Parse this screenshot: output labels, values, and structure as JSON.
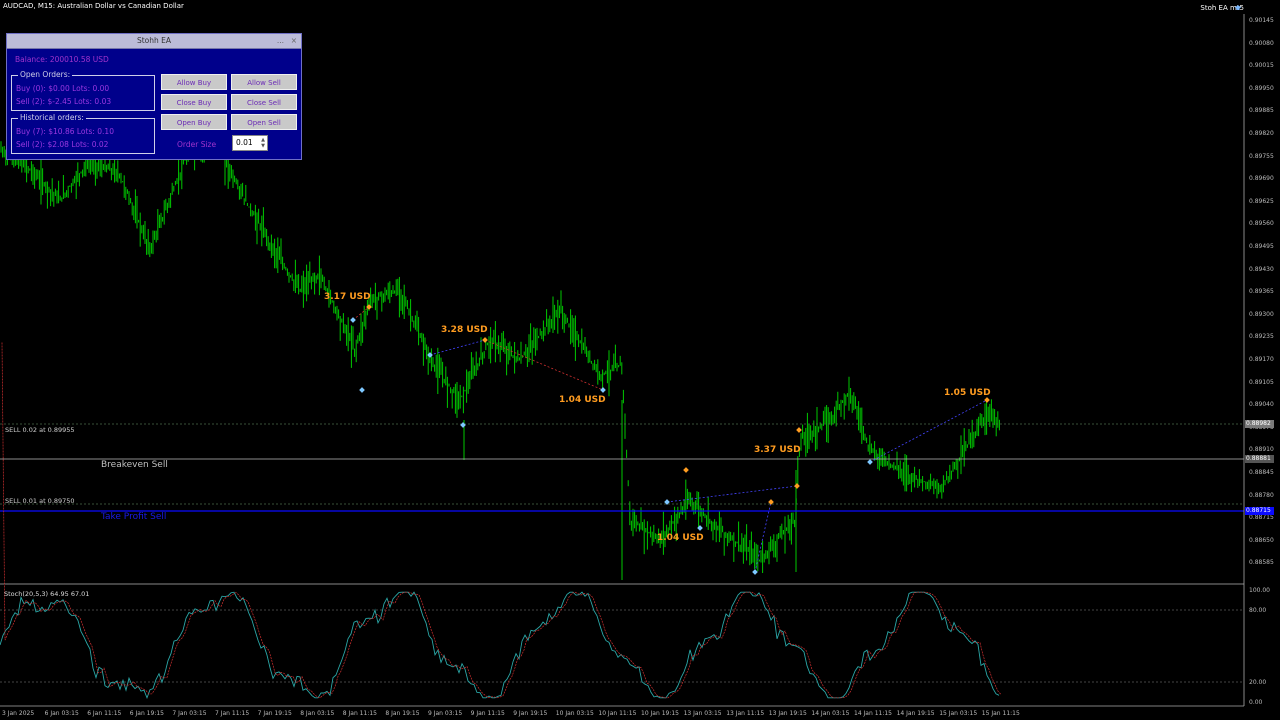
{
  "header": {
    "title": "AUDCAD, M15:  Australian Dollar vs Canadian Dollar",
    "ea_label": "Stoh EA mt5"
  },
  "panel": {
    "title": "Stohh EA",
    "minimize": "...",
    "close": "×",
    "balance": "Balance: 200010.58 USD",
    "open_orders_label": "Open Orders:",
    "open_buy": "Buy (0): $0.00 Lots: 0.00",
    "open_sell": "Sell (2): $-2.45 Lots: 0.03",
    "historical_label": "Historical orders:",
    "hist_buy": "Buy (7): $10.86 Lots: 0.10",
    "hist_sell": "Sell (2): $2.08 Lots: 0.02",
    "buttons": {
      "allow_buy": "Allow Buy",
      "allow_sell": "Allow Sell",
      "close_buy": "Close Buy",
      "close_sell": "Close Sell",
      "open_buy": "Open Buy",
      "open_sell": "Open Sell"
    },
    "order_size_label": "Order Size",
    "order_size_value": "0.01"
  },
  "chart": {
    "level_labels": {
      "sell1": "SELL 0.02 at 0.89955",
      "breakeven": "Breakeven Sell",
      "sell2": "SELL 0.01 at 0.89750",
      "take_profit": "Take Profit  Sell"
    },
    "profit_labels": [
      "3.17 USD",
      "3.28 USD",
      "1.04 USD",
      "3.37 USD",
      "1.04 USD",
      "1.05 USD"
    ],
    "price_axis": [
      "0.90145",
      "0.90080",
      "0.90015",
      "0.89950",
      "0.89885",
      "0.89820",
      "0.89755",
      "0.89690",
      "0.89625",
      "0.89560",
      "0.89495",
      "0.89430",
      "0.89365",
      "0.89300",
      "0.89235",
      "0.89170",
      "0.89105",
      "0.89040",
      "0.88975",
      "0.88910",
      "0.88845",
      "0.88780",
      "0.88715",
      "0.88650",
      "0.88585"
    ],
    "price_tags": {
      "current": "0.88982",
      "breakeven": "0.88881",
      "take_profit": "0.88715"
    },
    "time_axis": [
      "3 Jan 2025",
      "6 Jan 03:15",
      "6 Jan 11:15",
      "6 Jan 19:15",
      "7 Jan 03:15",
      "7 Jan 11:15",
      "7 Jan 19:15",
      "8 Jan 03:15",
      "8 Jan 11:15",
      "8 Jan 19:15",
      "9 Jan 03:15",
      "9 Jan 11:15",
      "9 Jan 19:15",
      "10 Jan 03:15",
      "10 Jan 11:15",
      "10 Jan 19:15",
      "13 Jan 03:15",
      "13 Jan 11:15",
      "13 Jan 19:15",
      "14 Jan 03:15",
      "14 Jan 11:15",
      "14 Jan 19:15",
      "15 Jan 03:15",
      "15 Jan 11:15"
    ],
    "colors": {
      "candles": "#00c800",
      "take_profit": "#0a0aff",
      "profit_text": "#ff9c20",
      "stoch_main": "#2aa7a7",
      "stoch_signal": "#d03030"
    }
  },
  "stochastic": {
    "title": "Stoch(20,5,3) 64.95 67.01",
    "axis": [
      "100.00",
      "80.00",
      "20.00",
      "0.00"
    ]
  }
}
